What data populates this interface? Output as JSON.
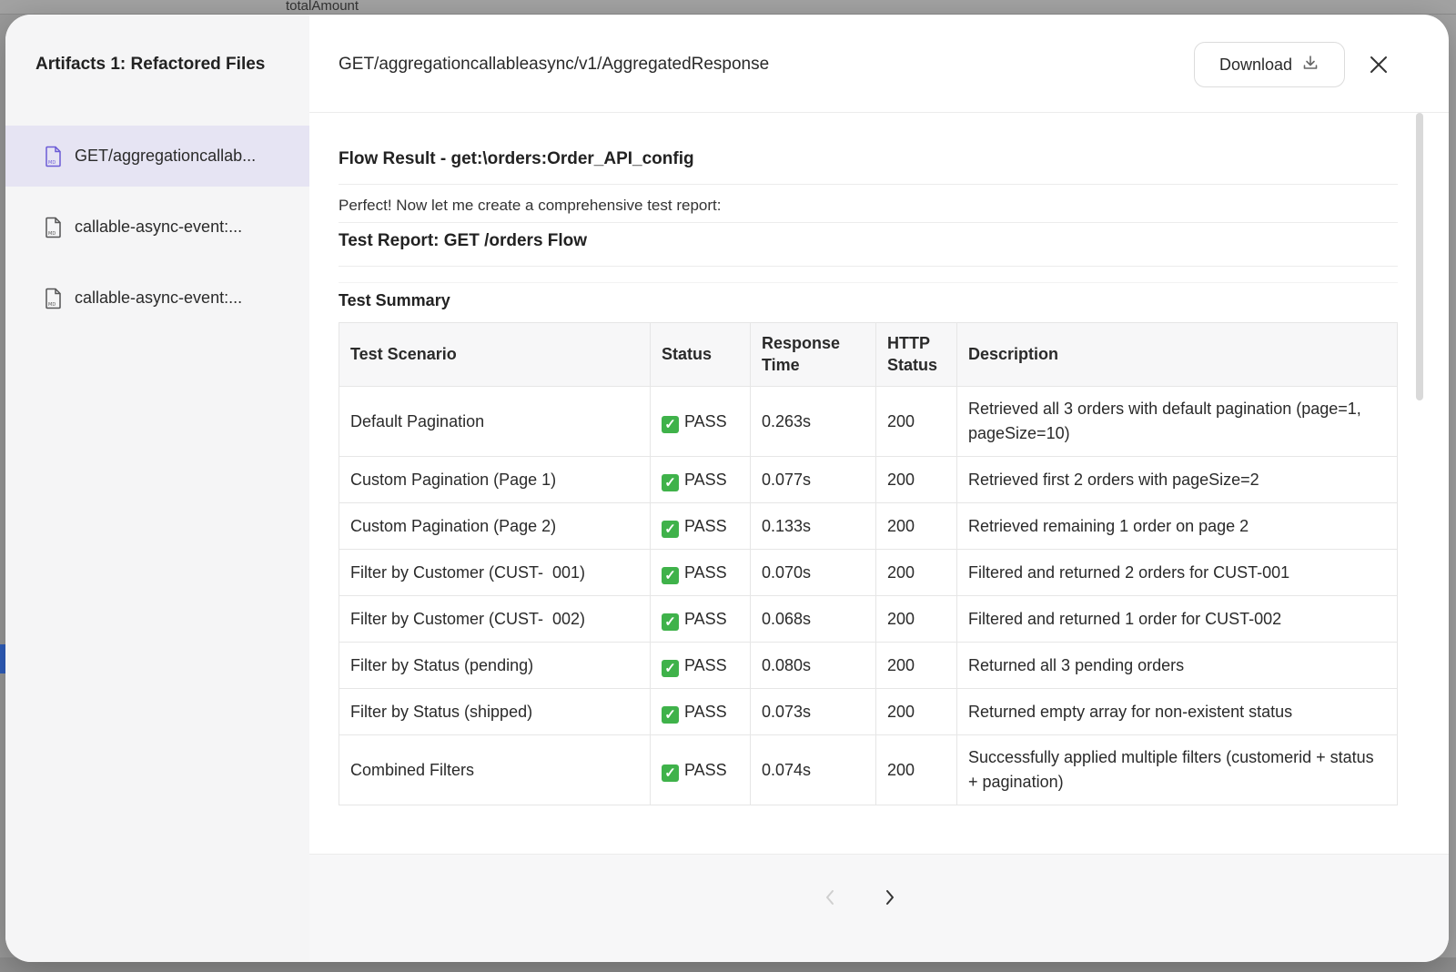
{
  "background": {
    "top_text": "totalAmount"
  },
  "sidebar": {
    "title": "Artifacts 1: Refactored Files",
    "files": [
      {
        "label": "GET/aggregationcallab...",
        "active": true
      },
      {
        "label": "callable-async-event:...",
        "active": false
      },
      {
        "label": "callable-async-event:...",
        "active": false
      }
    ]
  },
  "header": {
    "path": "GET/aggregationcallableasync/v1/AggregatedResponse",
    "download_label": "Download"
  },
  "content": {
    "flow_title": "Flow Result - get:\\orders:Order_API_config",
    "intro": "Perfect! Now let me create a comprehensive test report:",
    "report_title": "Test Report: GET /orders Flow",
    "summary_title": "Test Summary",
    "table": {
      "headers": [
        "Test Scenario",
        "Status",
        "Response Time",
        "HTTP Status",
        "Description"
      ],
      "rows": [
        {
          "scenario": "Default Pagination",
          "status": "PASS",
          "time": "0.263s",
          "http": "200",
          "desc": "Retrieved all 3 orders with default pagination (page=1, pageSize=10)"
        },
        {
          "scenario": "Custom Pagination (Page 1)",
          "status": "PASS",
          "time": "0.077s",
          "http": "200",
          "desc": "Retrieved first 2 orders with pageSize=2"
        },
        {
          "scenario": "Custom Pagination (Page 2)",
          "status": "PASS",
          "time": "0.133s",
          "http": "200",
          "desc": "Retrieved remaining 1 order on page 2"
        },
        {
          "scenario": "Filter by Customer (CUST-  001)",
          "status": "PASS",
          "time": "0.070s",
          "http": "200",
          "desc": "Filtered and returned 2 orders for CUST-001"
        },
        {
          "scenario": "Filter by Customer (CUST-  002)",
          "status": "PASS",
          "time": "0.068s",
          "http": "200",
          "desc": "Filtered and returned 1 order for CUST-002"
        },
        {
          "scenario": "Filter by Status (pending)",
          "status": "PASS",
          "time": "0.080s",
          "http": "200",
          "desc": "Returned all 3 pending orders"
        },
        {
          "scenario": "Filter by Status (shipped)",
          "status": "PASS",
          "time": "0.073s",
          "http": "200",
          "desc": "Returned empty array for non-existent status"
        },
        {
          "scenario": "Combined Filters",
          "status": "PASS",
          "time": "0.074s",
          "http": "200",
          "desc": "Successfully applied multiple filters (customerid + status  + pagination)"
        }
      ]
    }
  },
  "pagination": {
    "prev_icon": "chevron-left-icon",
    "next_icon": "chevron-right-icon"
  },
  "colors": {
    "active_file_bg": "#e6e4f3",
    "pass_check": "#3fb24a",
    "file_icon": "#6b5bd6"
  }
}
